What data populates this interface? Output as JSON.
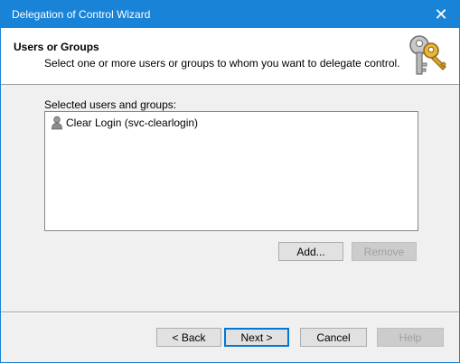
{
  "window": {
    "title": "Delegation of Control Wizard",
    "close_glyph": "✕",
    "accent_color": "#1883d7"
  },
  "header": {
    "title": "Users or Groups",
    "subtitle": "Select one or more users or groups to whom you want to delegate control.",
    "icon": "keys-icon"
  },
  "selection": {
    "label": "Selected users and groups:",
    "items": [
      {
        "icon": "user-icon",
        "text": "Clear Login (svc-clearlogin)"
      }
    ]
  },
  "list_buttons": {
    "add": "Add...",
    "remove": "Remove",
    "remove_disabled": true
  },
  "footer": {
    "back": "< Back",
    "next": "Next >",
    "cancel": "Cancel",
    "help": "Help",
    "help_disabled": true
  }
}
